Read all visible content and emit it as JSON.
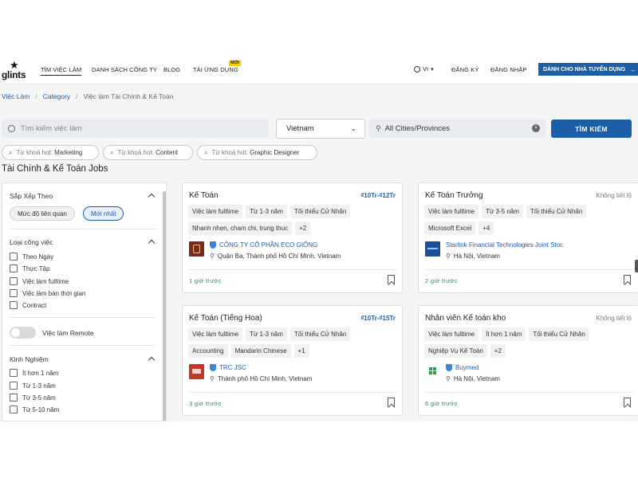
{
  "nav": {
    "logo": "glints",
    "links": [
      "TÌM VIỆC LÀM",
      "DANH SÁCH CÔNG TY",
      "BLOG",
      "TẢI ỨNG DỤNG"
    ],
    "new_badge": "MỚI",
    "lang": "VI",
    "register": "ĐĂNG KÝ",
    "login": "ĐĂNG NHẬP",
    "employer_button": "DÀNH CHO NHÀ TUYỂN DỤNG"
  },
  "breadcrumb": [
    "Việc Làm",
    "Category",
    "Việc làm Tài Chính & Kế Toán"
  ],
  "search": {
    "placeholder": "Tìm kiếm việc làm",
    "country": "Vietnam",
    "city": "All Cities/Provinces",
    "button": "TÌM KIẾM"
  },
  "hot_keywords": {
    "prefix": "Từ khoá hot:",
    "items": [
      "Marketing",
      "Content",
      "Graphic Designer"
    ]
  },
  "page_title": "Tài Chính & Kế Toán Jobs",
  "filters": {
    "sort": {
      "title": "Sắp Xếp Theo",
      "options": [
        "Mức độ liên quan",
        "Mới nhất"
      ],
      "selected": "Mới nhất"
    },
    "job_type": {
      "title": "Loại công việc",
      "options": [
        "Theo Ngày",
        "Thực Tập",
        "Việc làm fulltime",
        "Việc làm bán thời gian",
        "Contract"
      ]
    },
    "remote": {
      "label": "Việc làm Remote",
      "on": false
    },
    "experience": {
      "title": "Kinh Nghiệm",
      "options": [
        "Ít hơn 1 năm",
        "Từ 1-3 năm",
        "Từ 3-5 năm",
        "Từ 5-10 năm"
      ]
    }
  },
  "jobs": [
    {
      "title": "Kế Toán",
      "salary": "₫10Tr-₫12Tr",
      "tags": [
        [
          "Việc làm fulltime",
          "Từ 1-3 năm",
          "Tối thiểu Cử Nhân"
        ],
        [
          "Nhanh nhẹn, cham chi, trung thuc",
          "+2"
        ]
      ],
      "company": "CÔNG TY CỔ PHẦN ECO GIỐNG",
      "location": "Quận Ba, Thành phố Hồ Chí Minh, Vietnam",
      "posted": "1 giờ trước",
      "logo_color": "#7a2a1a"
    },
    {
      "title": "Kế Toán Trưởng",
      "salary": "Không tiết lộ",
      "tags": [
        [
          "Việc làm fulltime",
          "Từ 3-5 năm",
          "Tối thiểu Cử Nhân"
        ],
        [
          "Microsoft Excel",
          "+4"
        ]
      ],
      "company": "Starlink Financial Technologies Joint Stoc",
      "location": "Hà Nội, Vietnam",
      "posted": "2 giờ trước",
      "logo_color": "#1a4fa0"
    },
    {
      "title": "Kế Toán (Tiếng Hoa)",
      "salary": "₫10Tr-₫15Tr",
      "tags": [
        [
          "Việc làm fulltime",
          "Từ 1-3 năm",
          "Tối thiểu Cử Nhân"
        ],
        [
          "Accounting",
          "Mandarin Chinese",
          "+1"
        ]
      ],
      "company": "TRC JSC",
      "location": "Thành phố Hồ Chí Minh, Vietnam",
      "posted": "3 giờ trước",
      "logo_color": "#c0392b"
    },
    {
      "title": "Nhân viên Kế toán kho",
      "salary": "Không tiết lộ",
      "tags": [
        [
          "Việc làm fulltime",
          "Ít hơn 1 năm",
          "Tối thiểu Cử Nhân"
        ],
        [
          "Nghiệp Vụ Kế Toán",
          "+2"
        ]
      ],
      "company": "Buymed",
      "location": "Hà Nội, Vietnam",
      "posted": "6 giờ trước",
      "logo_color": "#2e9a4a"
    }
  ]
}
